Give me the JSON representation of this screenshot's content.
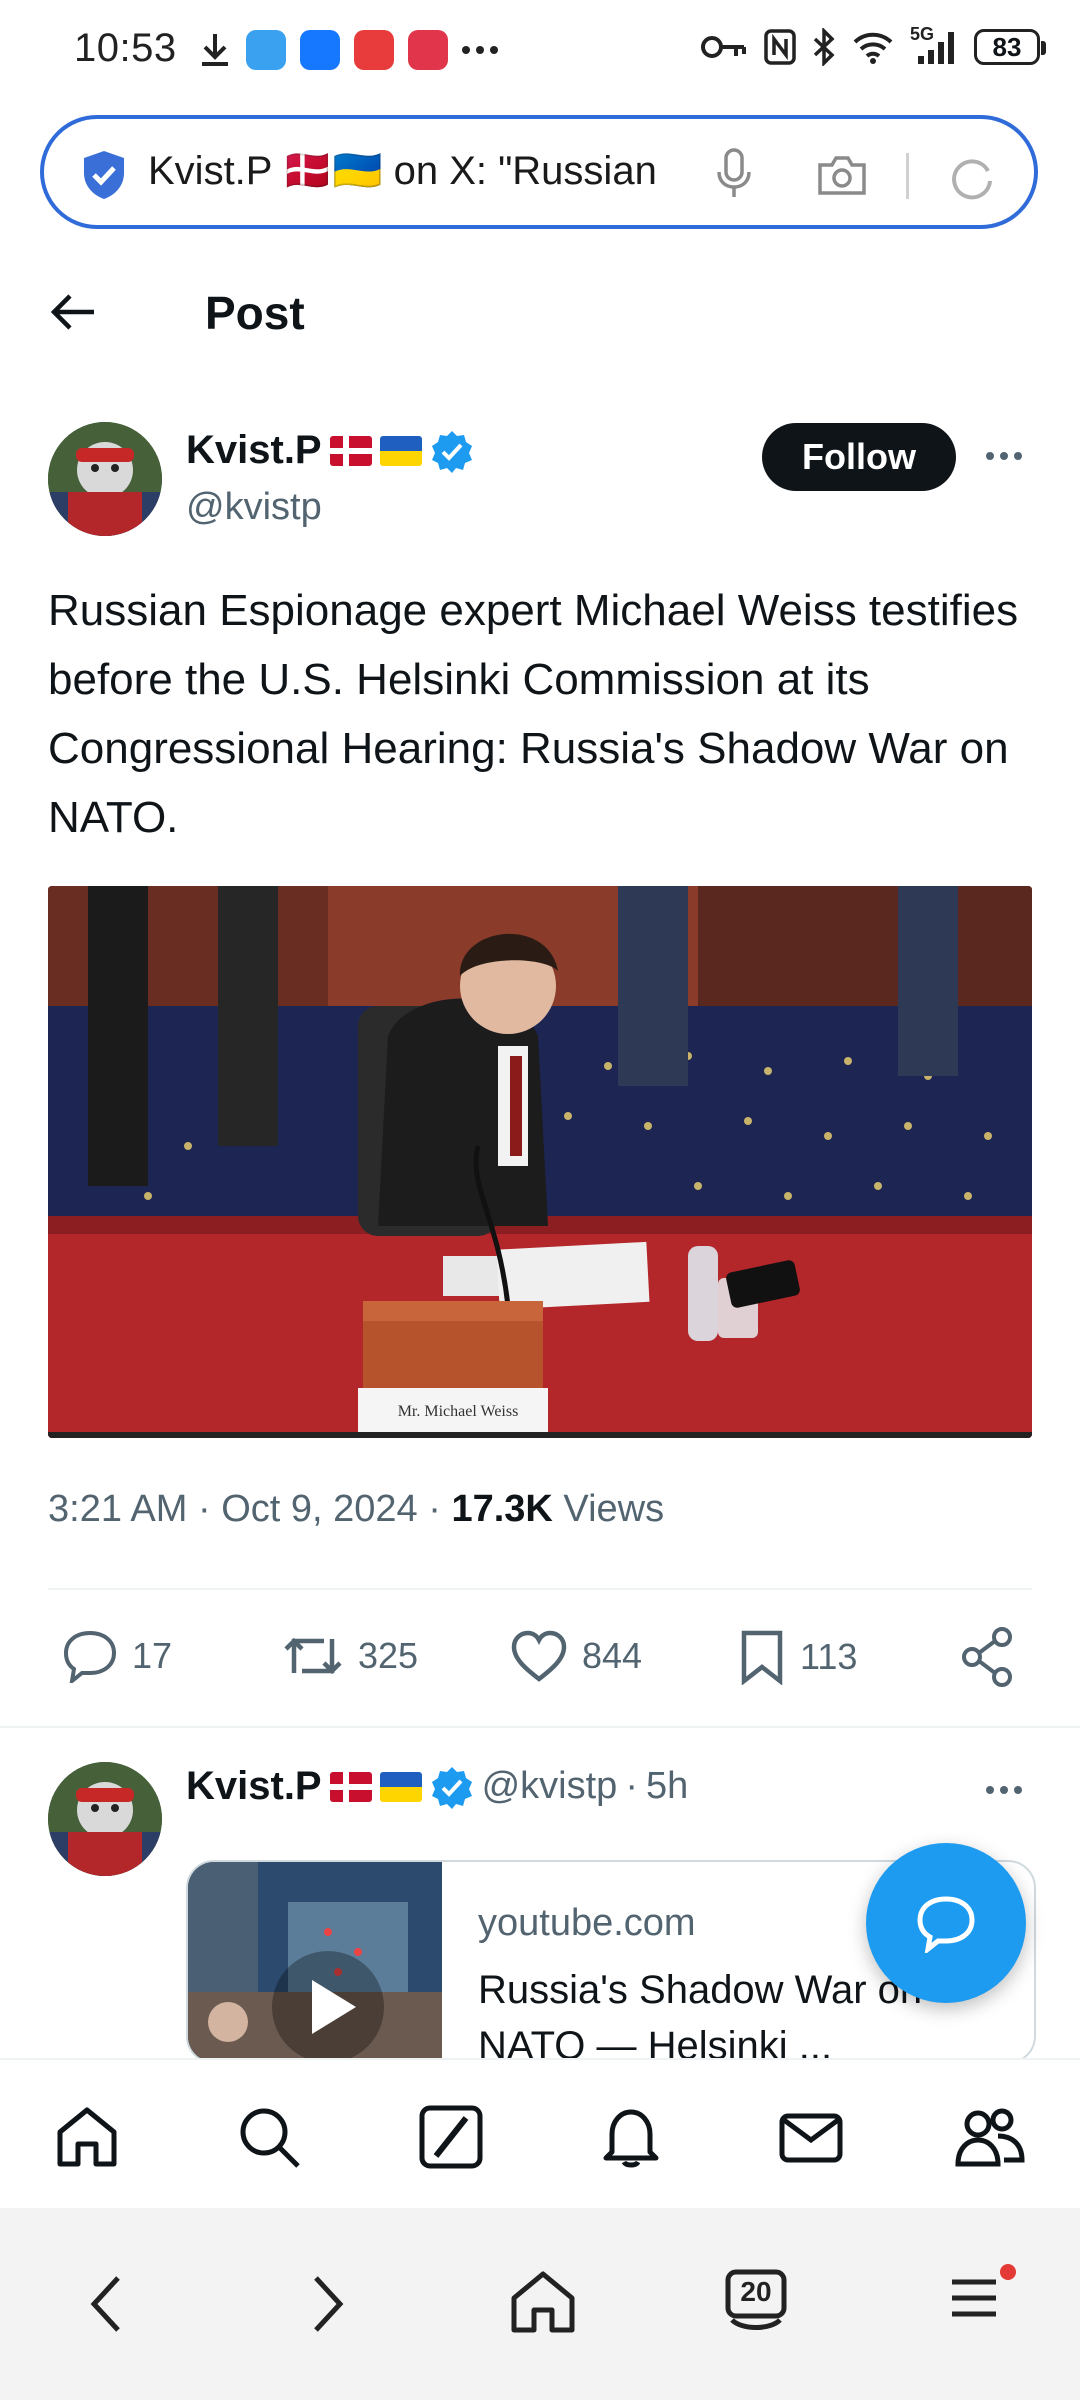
{
  "status_bar": {
    "time": "10:53",
    "battery": "83",
    "network": "5G"
  },
  "url_bar": {
    "text": "Kvist.P 🇩🇰🇺🇦 on X: \"Russian"
  },
  "header": {
    "title": "Post"
  },
  "post": {
    "author_name": "Kvist.P",
    "author_handle": "@kvistp",
    "follow_label": "Follow",
    "text": "Russian Espionage expert Michael Weiss testifies before the U.S. Helsinki Commission at its Congressional Hearing: Russia's Shadow War on NATO.",
    "media_placard": "Mr. Michael Weiss",
    "time": "3:21 AM",
    "date": "Oct 9, 2024",
    "views_count": "17.3K",
    "views_label": "Views",
    "replies": "17",
    "reposts": "325",
    "likes": "844",
    "bookmarks": "113"
  },
  "reply_post": {
    "author_name": "Kvist.P",
    "author_handle": "@kvistp",
    "age": "5h",
    "card": {
      "domain": "youtube.com",
      "title": "Russia's Shadow War on NATO — Helsinki ..."
    }
  },
  "browser_nav": {
    "tabs_count": "20"
  },
  "colors": {
    "accent": "#1d9bf0",
    "url_border": "#2f6bd9",
    "text_secondary": "#536471"
  }
}
